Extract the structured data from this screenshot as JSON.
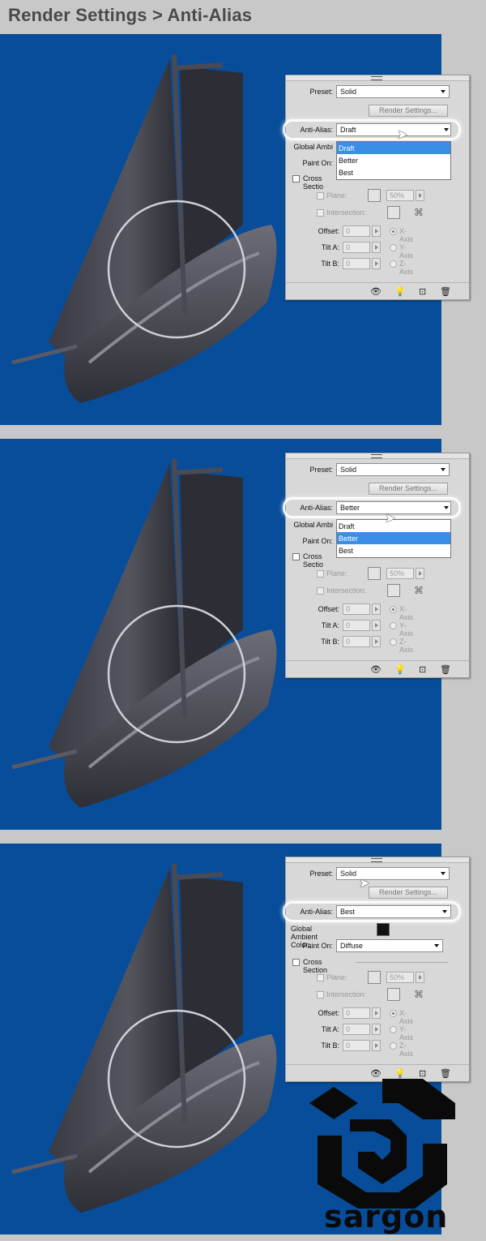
{
  "page_title": "Render Settings > Anti-Alias",
  "panels": [
    {
      "preset_label": "Preset:",
      "preset_value": "Solid",
      "render_settings_button": "Render Settings...",
      "anti_alias_label": "Anti-Alias:",
      "anti_alias_value": "Draft",
      "dropdown_open": true,
      "dropdown_options": [
        "Draft",
        "Better",
        "Best"
      ],
      "dropdown_highlighted": "Draft",
      "global_ambient_label": "Global Ambi",
      "paint_on_label": "Paint On:",
      "cross_section_label": "Cross Sectio",
      "plane_label": "Plane:",
      "plane_percent": "50%",
      "intersection_label": "Intersection:",
      "offset_label": "Offset:",
      "offset_value": "0",
      "tilt_a_label": "Tilt A:",
      "tilt_a_value": "0",
      "tilt_b_label": "Tilt B:",
      "tilt_b_value": "0",
      "x_axis_label": "X-Axis",
      "y_axis_label": "Y-Axis",
      "z_axis_label": "Z-Axis"
    },
    {
      "preset_label": "Preset:",
      "preset_value": "Solid",
      "render_settings_button": "Render Settings...",
      "anti_alias_label": "Anti-Alias:",
      "anti_alias_value": "Better",
      "dropdown_open": true,
      "dropdown_options": [
        "Draft",
        "Better",
        "Best"
      ],
      "dropdown_highlighted": "Better",
      "global_ambient_label": "Global Ambi",
      "paint_on_label": "Paint On:",
      "cross_section_label": "Cross Sectio",
      "plane_label": "Plane:",
      "plane_percent": "50%",
      "intersection_label": "Intersection:",
      "offset_label": "Offset:",
      "offset_value": "0",
      "tilt_a_label": "Tilt A:",
      "tilt_a_value": "0",
      "tilt_b_label": "Tilt B:",
      "tilt_b_value": "0",
      "x_axis_label": "X-Axis",
      "y_axis_label": "Y-Axis",
      "z_axis_label": "Z-Axis"
    },
    {
      "preset_label": "Preset:",
      "preset_value": "Solid",
      "render_settings_button": "Render Settings...",
      "anti_alias_label": "Anti-Alias:",
      "anti_alias_value": "Best",
      "dropdown_open": false,
      "global_ambient_label": "Global Ambient Color:",
      "paint_on_label": "Paint On:",
      "paint_on_value": "Diffuse",
      "cross_section_label": "Cross Section",
      "plane_label": "Plane:",
      "plane_percent": "50%",
      "intersection_label": "Intersection:",
      "offset_label": "Offset:",
      "offset_value": "0",
      "tilt_a_label": "Tilt A:",
      "tilt_a_value": "0",
      "tilt_b_label": "Tilt B:",
      "tilt_b_value": "0",
      "x_axis_label": "X-Axis",
      "y_axis_label": "Y-Axis",
      "z_axis_label": "Z-Axis"
    }
  ],
  "colors": {
    "viewport_bg": "#074d9a",
    "panel_bg": "#d8d8d8",
    "highlight": "#3a8ee6"
  },
  "logo_text": "sargon"
}
